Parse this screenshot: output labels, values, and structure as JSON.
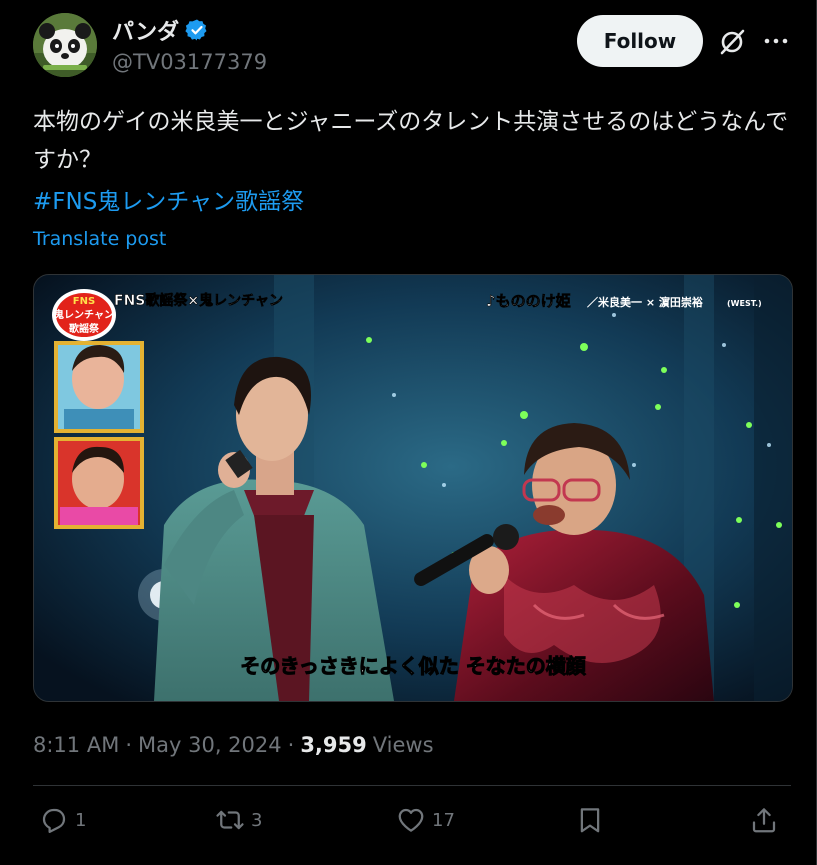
{
  "author": {
    "display_name": "パンダ",
    "handle": "@TV03177379",
    "verified": true,
    "verified_color": "#1d9bf0"
  },
  "header": {
    "follow_label": "Follow",
    "grok_icon": "grok-slash-icon",
    "more_icon": "more-dots-icon"
  },
  "tweet": {
    "text": "本物のゲイの米良美一とジャニーズのタレント共演させるのはどうなんですか？",
    "hashtag": "#FNS鬼レンチャン歌謡祭",
    "translate_label": "Translate post"
  },
  "media": {
    "show_logo_lines": [
      "FNS",
      "鬼レンチャン",
      "歌謡祭"
    ],
    "show_title": "FNS歌謡祭×鬼レンチャン",
    "song_title": "♪もののけ姫",
    "performers": "／米良美一 × 濵田崇裕",
    "performers_group": "(WEST.)",
    "subtitle": "そのきっさきによく似た そなたの横顔"
  },
  "meta": {
    "time": "8:11 AM",
    "separator": "·",
    "date": "May 30, 2024",
    "views_count": "3,959",
    "views_label": "Views"
  },
  "actions": {
    "replies": "1",
    "reposts": "3",
    "likes": "17",
    "icons": [
      "reply-icon",
      "repost-icon",
      "like-icon",
      "bookmark-icon",
      "share-icon"
    ]
  },
  "colors": {
    "background": "#000000",
    "text": "#e7e9ea",
    "muted": "#71767b",
    "link": "#1d9bf0",
    "follow_bg": "#eff3f4"
  }
}
